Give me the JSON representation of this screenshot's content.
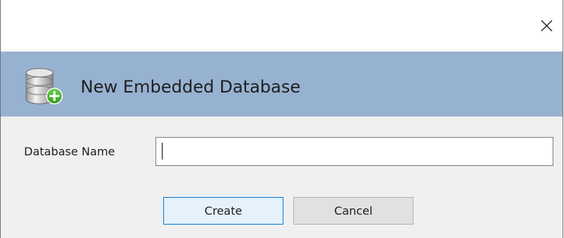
{
  "window": {
    "close_icon": "close-icon"
  },
  "banner": {
    "icon": "database-add-icon",
    "title": "New Embedded Database",
    "background": "#97b2d1"
  },
  "form": {
    "database_name_label": "Database Name",
    "database_name_value": ""
  },
  "buttons": {
    "create_label": "Create",
    "cancel_label": "Cancel",
    "accent": "#0078d7"
  }
}
